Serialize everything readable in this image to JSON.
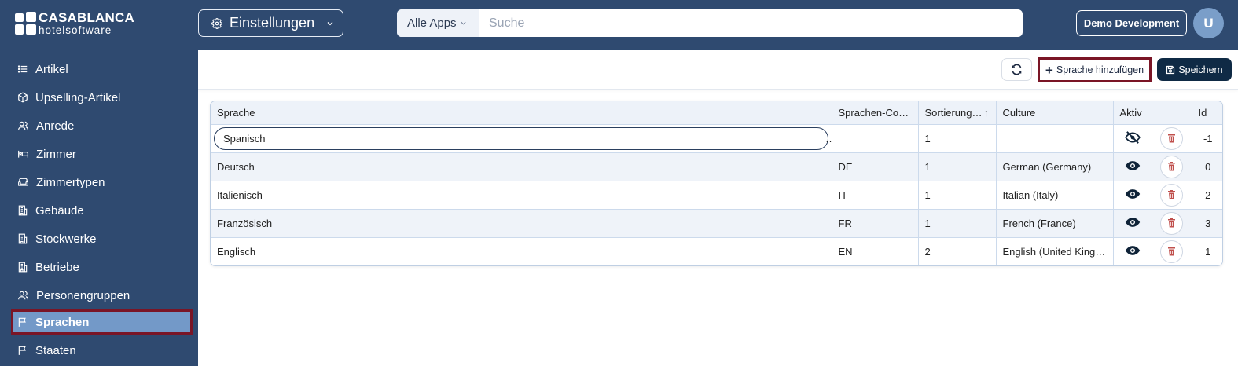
{
  "header": {
    "logo_title": "CASABLANCA",
    "logo_subtitle": "hotelsoftware",
    "module_label": "Einstellungen",
    "search_scope": "Alle Apps",
    "search_placeholder": "Suche",
    "environment_label": "Demo Development",
    "avatar_initial": "U"
  },
  "sidebar": {
    "items": [
      {
        "label": "Artikel",
        "icon": "list-icon"
      },
      {
        "label": "Upselling-Artikel",
        "icon": "box-icon"
      },
      {
        "label": "Anrede",
        "icon": "users-icon"
      },
      {
        "label": "Zimmer",
        "icon": "bed-icon"
      },
      {
        "label": "Zimmertypen",
        "icon": "sofa-icon"
      },
      {
        "label": "Gebäude",
        "icon": "building-icon"
      },
      {
        "label": "Stockwerke",
        "icon": "building-icon"
      },
      {
        "label": "Betriebe",
        "icon": "building-icon"
      },
      {
        "label": "Personengruppen",
        "icon": "users-icon"
      },
      {
        "label": "Sprachen",
        "icon": "flag-icon",
        "active": true
      },
      {
        "label": "Staaten",
        "icon": "flag-icon"
      }
    ]
  },
  "toolbar": {
    "add_label": "Sprache hinzufügen",
    "save_label": "Speichern"
  },
  "table": {
    "columns": [
      "Sprache",
      "Sprachen-Co…",
      "Sortierung…",
      "Culture",
      "Aktiv",
      "",
      "Id"
    ],
    "sort_indicator": "↑",
    "editing_value": "Spanisch",
    "rows": [
      {
        "sprache": "Spanisch",
        "code": "",
        "sort": "1",
        "culture": "",
        "aktiv": false,
        "id": "-1"
      },
      {
        "sprache": "Deutsch",
        "code": "DE",
        "sort": "1",
        "culture": "German (Germany)",
        "aktiv": true,
        "id": "0"
      },
      {
        "sprache": "Italienisch",
        "code": "IT",
        "sort": "1",
        "culture": "Italian (Italy)",
        "aktiv": true,
        "id": "2"
      },
      {
        "sprache": "Französisch",
        "code": "FR",
        "sort": "1",
        "culture": "French (France)",
        "aktiv": true,
        "id": "3"
      },
      {
        "sprache": "Englisch",
        "code": "EN",
        "sort": "2",
        "culture": "English (United King…",
        "aktiv": true,
        "id": "1"
      }
    ]
  },
  "colors": {
    "navy": "#2f4a70",
    "active_nav": "#7399c8",
    "highlight_border": "#7a1526",
    "save_button": "#0f2a45",
    "delete_icon": "#c0504d"
  }
}
